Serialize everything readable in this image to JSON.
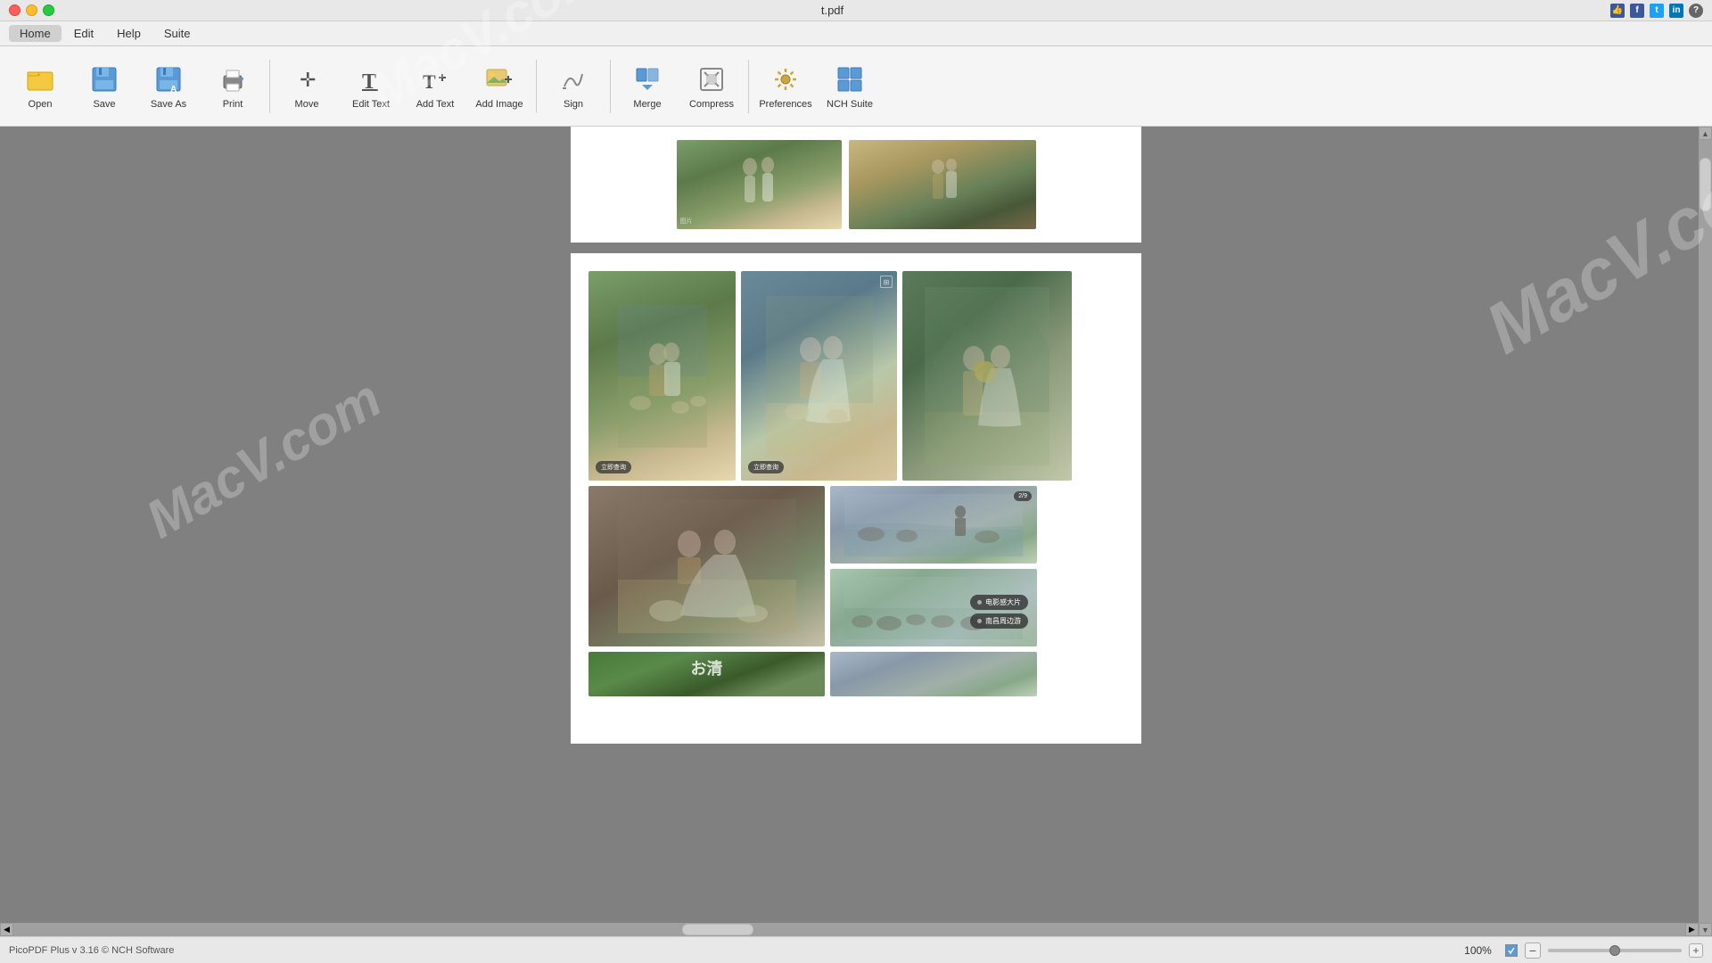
{
  "app": {
    "title": "t.pdf",
    "version": "PicoPDF Plus v 3.16 © NCH Software"
  },
  "watermarks": [
    {
      "text": "MacV.com",
      "class": "watermark-1"
    },
    {
      "text": "MacV.co",
      "class": "watermark-2"
    },
    {
      "text": "MacV.com",
      "class": "watermark-3"
    }
  ],
  "titlebar": {
    "title": "t.pdf",
    "social_icons": [
      "👍",
      "f",
      "t",
      "in",
      "?"
    ]
  },
  "menubar": {
    "items": [
      {
        "label": "Home",
        "active": true
      },
      {
        "label": "Edit"
      },
      {
        "label": "Help"
      },
      {
        "label": "Suite"
      }
    ]
  },
  "toolbar": {
    "buttons": [
      {
        "id": "open",
        "label": "Open",
        "icon": "📂"
      },
      {
        "id": "save",
        "label": "Save",
        "icon": "💾"
      },
      {
        "id": "save-as",
        "label": "Save As",
        "icon": "💾"
      },
      {
        "id": "print",
        "label": "Print",
        "icon": "🖨️"
      },
      {
        "id": "move",
        "label": "Move",
        "icon": "✛"
      },
      {
        "id": "edit-text",
        "label": "Edit Text",
        "icon": "T"
      },
      {
        "id": "add-text",
        "label": "Add Text",
        "icon": "T+"
      },
      {
        "id": "add-image",
        "label": "Add Image",
        "icon": "🖼️"
      },
      {
        "id": "sign",
        "label": "Sign",
        "icon": "✒️"
      },
      {
        "id": "merge",
        "label": "Merge",
        "icon": "⊞"
      },
      {
        "id": "compress",
        "label": "Compress",
        "icon": "⊡"
      },
      {
        "id": "preferences",
        "label": "Preferences",
        "icon": "🎛️"
      },
      {
        "id": "nch-suite",
        "label": "NCH Suite",
        "icon": "⊞"
      }
    ]
  },
  "statusbar": {
    "text": "PicoPDF Plus v 3.16 © NCH Software",
    "zoom": "100%",
    "zoom_checked": true
  },
  "photos": {
    "page1": [
      {
        "desc": "couple outdoor green field",
        "badge": ""
      },
      {
        "desc": "couple warm tones holding hands",
        "badge": ""
      }
    ],
    "page2_top": [
      {
        "desc": "couple with goats outdoor",
        "badge": "立即查询"
      },
      {
        "desc": "couple sitting wedding dress goats",
        "badge": "立即查询"
      },
      {
        "desc": "couple flowers field",
        "badge": ""
      }
    ],
    "page2_bottom": [
      {
        "desc": "couple crouching white dress",
        "badge": ""
      },
      {
        "desc": "lake with animals bird",
        "badge": "2/9",
        "isBadgeNum": true
      },
      {
        "desc": "grassland with cattle lake",
        "chat1": "电影感大片",
        "chat2": "南昌周边游"
      }
    ],
    "page2_extra": [
      {
        "desc": "tree green",
        "text": "お清"
      }
    ]
  }
}
